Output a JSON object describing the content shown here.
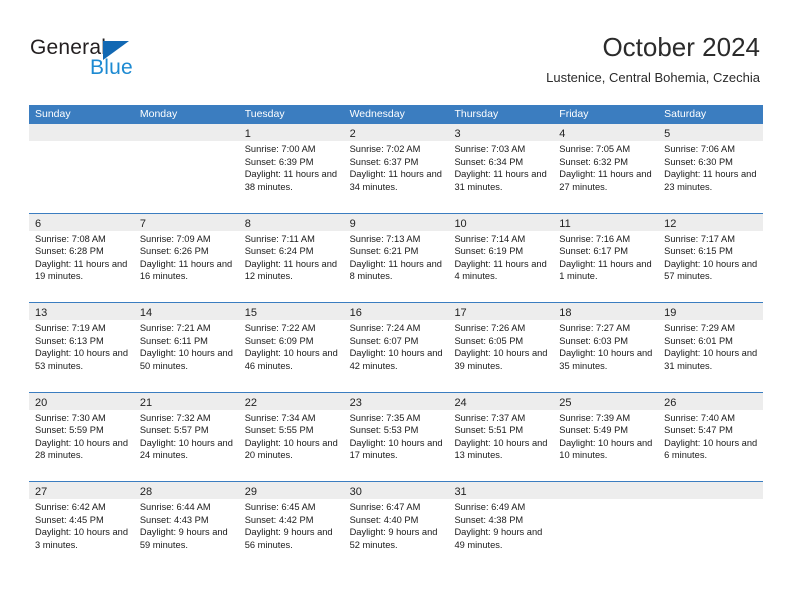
{
  "brand": {
    "name_part1": "General",
    "name_part2": "Blue",
    "triangle_color": "#1268b3",
    "blue_color": "#1d8ad2"
  },
  "header": {
    "title": "October 2024",
    "subtitle": "Lustenice, Central Bohemia, Czechia"
  },
  "theme": {
    "header_blue": "#3b7dc0",
    "day_band_gray": "#ededed",
    "text_color": "#1a1a1a"
  },
  "weekdays": [
    "Sunday",
    "Monday",
    "Tuesday",
    "Wednesday",
    "Thursday",
    "Friday",
    "Saturday"
  ],
  "weeks": [
    [
      {
        "day": "",
        "sunrise": "",
        "sunset": "",
        "daylight": "",
        "empty": true
      },
      {
        "day": "",
        "sunrise": "",
        "sunset": "",
        "daylight": "",
        "empty": true
      },
      {
        "day": "1",
        "sunrise": "Sunrise: 7:00 AM",
        "sunset": "Sunset: 6:39 PM",
        "daylight": "Daylight: 11 hours and 38 minutes."
      },
      {
        "day": "2",
        "sunrise": "Sunrise: 7:02 AM",
        "sunset": "Sunset: 6:37 PM",
        "daylight": "Daylight: 11 hours and 34 minutes."
      },
      {
        "day": "3",
        "sunrise": "Sunrise: 7:03 AM",
        "sunset": "Sunset: 6:34 PM",
        "daylight": "Daylight: 11 hours and 31 minutes."
      },
      {
        "day": "4",
        "sunrise": "Sunrise: 7:05 AM",
        "sunset": "Sunset: 6:32 PM",
        "daylight": "Daylight: 11 hours and 27 minutes."
      },
      {
        "day": "5",
        "sunrise": "Sunrise: 7:06 AM",
        "sunset": "Sunset: 6:30 PM",
        "daylight": "Daylight: 11 hours and 23 minutes."
      }
    ],
    [
      {
        "day": "6",
        "sunrise": "Sunrise: 7:08 AM",
        "sunset": "Sunset: 6:28 PM",
        "daylight": "Daylight: 11 hours and 19 minutes."
      },
      {
        "day": "7",
        "sunrise": "Sunrise: 7:09 AM",
        "sunset": "Sunset: 6:26 PM",
        "daylight": "Daylight: 11 hours and 16 minutes."
      },
      {
        "day": "8",
        "sunrise": "Sunrise: 7:11 AM",
        "sunset": "Sunset: 6:24 PM",
        "daylight": "Daylight: 11 hours and 12 minutes."
      },
      {
        "day": "9",
        "sunrise": "Sunrise: 7:13 AM",
        "sunset": "Sunset: 6:21 PM",
        "daylight": "Daylight: 11 hours and 8 minutes."
      },
      {
        "day": "10",
        "sunrise": "Sunrise: 7:14 AM",
        "sunset": "Sunset: 6:19 PM",
        "daylight": "Daylight: 11 hours and 4 minutes."
      },
      {
        "day": "11",
        "sunrise": "Sunrise: 7:16 AM",
        "sunset": "Sunset: 6:17 PM",
        "daylight": "Daylight: 11 hours and 1 minute."
      },
      {
        "day": "12",
        "sunrise": "Sunrise: 7:17 AM",
        "sunset": "Sunset: 6:15 PM",
        "daylight": "Daylight: 10 hours and 57 minutes."
      }
    ],
    [
      {
        "day": "13",
        "sunrise": "Sunrise: 7:19 AM",
        "sunset": "Sunset: 6:13 PM",
        "daylight": "Daylight: 10 hours and 53 minutes."
      },
      {
        "day": "14",
        "sunrise": "Sunrise: 7:21 AM",
        "sunset": "Sunset: 6:11 PM",
        "daylight": "Daylight: 10 hours and 50 minutes."
      },
      {
        "day": "15",
        "sunrise": "Sunrise: 7:22 AM",
        "sunset": "Sunset: 6:09 PM",
        "daylight": "Daylight: 10 hours and 46 minutes."
      },
      {
        "day": "16",
        "sunrise": "Sunrise: 7:24 AM",
        "sunset": "Sunset: 6:07 PM",
        "daylight": "Daylight: 10 hours and 42 minutes."
      },
      {
        "day": "17",
        "sunrise": "Sunrise: 7:26 AM",
        "sunset": "Sunset: 6:05 PM",
        "daylight": "Daylight: 10 hours and 39 minutes."
      },
      {
        "day": "18",
        "sunrise": "Sunrise: 7:27 AM",
        "sunset": "Sunset: 6:03 PM",
        "daylight": "Daylight: 10 hours and 35 minutes."
      },
      {
        "day": "19",
        "sunrise": "Sunrise: 7:29 AM",
        "sunset": "Sunset: 6:01 PM",
        "daylight": "Daylight: 10 hours and 31 minutes."
      }
    ],
    [
      {
        "day": "20",
        "sunrise": "Sunrise: 7:30 AM",
        "sunset": "Sunset: 5:59 PM",
        "daylight": "Daylight: 10 hours and 28 minutes."
      },
      {
        "day": "21",
        "sunrise": "Sunrise: 7:32 AM",
        "sunset": "Sunset: 5:57 PM",
        "daylight": "Daylight: 10 hours and 24 minutes."
      },
      {
        "day": "22",
        "sunrise": "Sunrise: 7:34 AM",
        "sunset": "Sunset: 5:55 PM",
        "daylight": "Daylight: 10 hours and 20 minutes."
      },
      {
        "day": "23",
        "sunrise": "Sunrise: 7:35 AM",
        "sunset": "Sunset: 5:53 PM",
        "daylight": "Daylight: 10 hours and 17 minutes."
      },
      {
        "day": "24",
        "sunrise": "Sunrise: 7:37 AM",
        "sunset": "Sunset: 5:51 PM",
        "daylight": "Daylight: 10 hours and 13 minutes."
      },
      {
        "day": "25",
        "sunrise": "Sunrise: 7:39 AM",
        "sunset": "Sunset: 5:49 PM",
        "daylight": "Daylight: 10 hours and 10 minutes."
      },
      {
        "day": "26",
        "sunrise": "Sunrise: 7:40 AM",
        "sunset": "Sunset: 5:47 PM",
        "daylight": "Daylight: 10 hours and 6 minutes."
      }
    ],
    [
      {
        "day": "27",
        "sunrise": "Sunrise: 6:42 AM",
        "sunset": "Sunset: 4:45 PM",
        "daylight": "Daylight: 10 hours and 3 minutes."
      },
      {
        "day": "28",
        "sunrise": "Sunrise: 6:44 AM",
        "sunset": "Sunset: 4:43 PM",
        "daylight": "Daylight: 9 hours and 59 minutes."
      },
      {
        "day": "29",
        "sunrise": "Sunrise: 6:45 AM",
        "sunset": "Sunset: 4:42 PM",
        "daylight": "Daylight: 9 hours and 56 minutes."
      },
      {
        "day": "30",
        "sunrise": "Sunrise: 6:47 AM",
        "sunset": "Sunset: 4:40 PM",
        "daylight": "Daylight: 9 hours and 52 minutes."
      },
      {
        "day": "31",
        "sunrise": "Sunrise: 6:49 AM",
        "sunset": "Sunset: 4:38 PM",
        "daylight": "Daylight: 9 hours and 49 minutes."
      },
      {
        "day": "",
        "sunrise": "",
        "sunset": "",
        "daylight": "",
        "empty": true
      },
      {
        "day": "",
        "sunrise": "",
        "sunset": "",
        "daylight": "",
        "empty": true
      }
    ]
  ]
}
